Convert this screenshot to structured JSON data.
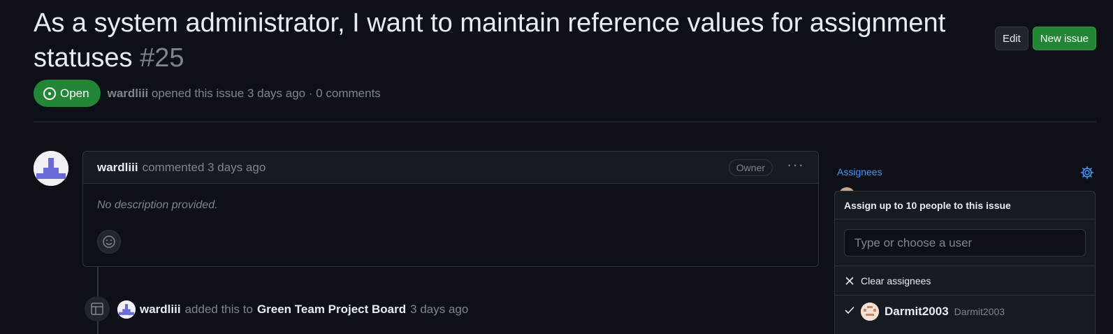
{
  "issue": {
    "title": "As a system administrator, I want to maintain reference values for assignment statuses",
    "number": "#25",
    "state": "Open",
    "author": "wardliii",
    "opened_text": "opened this issue 3 days ago · 0 comments"
  },
  "header": {
    "edit_label": "Edit",
    "new_issue_label": "New issue"
  },
  "comment": {
    "author": "wardliii",
    "meta": "commented 3 days ago",
    "badge": "Owner",
    "body": "No description provided."
  },
  "event": {
    "author": "wardliii",
    "action": "added this to",
    "board": "Green Team Project Board",
    "time": "3 days ago"
  },
  "sidebar": {
    "assignees_label": "Assignees"
  },
  "assignee_dropdown": {
    "header": "Assign up to 10 people to this issue",
    "placeholder": "Type or choose a user",
    "clear_label": "Clear assignees",
    "users": [
      {
        "login": "Darmit2003",
        "name": "Darmit2003",
        "selected": true
      }
    ]
  },
  "colors": {
    "open_green": "#238636",
    "link_blue": "#4493f8",
    "background": "#0d1117"
  },
  "icons": [
    "issue-opened-icon",
    "kebab-horizontal-icon",
    "smiley-icon",
    "project-table-icon",
    "gear-icon",
    "x-icon",
    "check-icon"
  ]
}
